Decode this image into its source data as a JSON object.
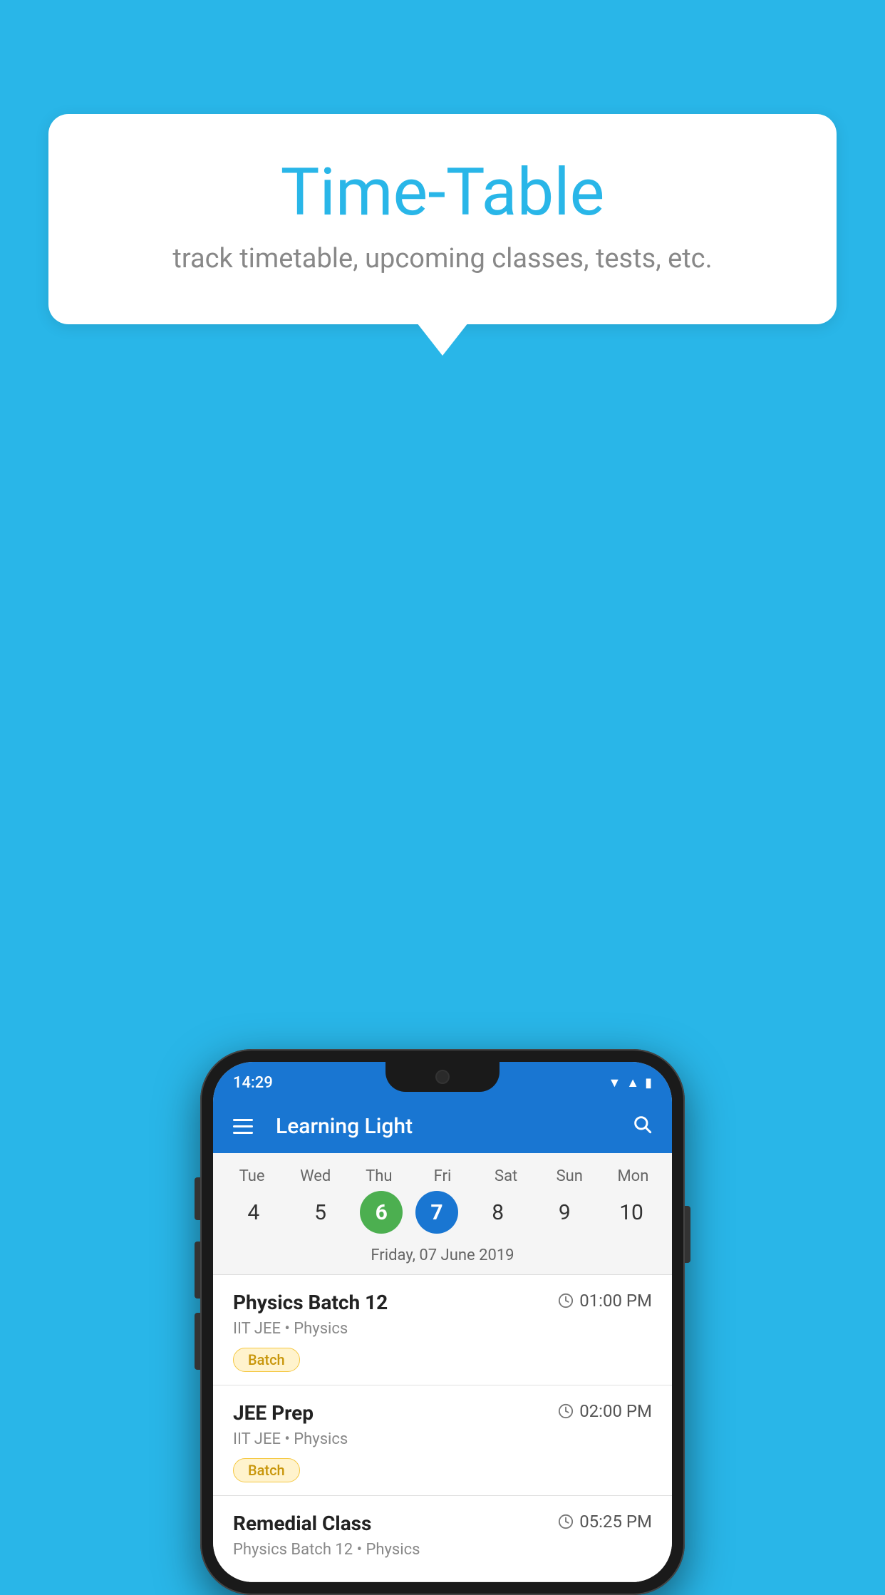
{
  "background": {
    "color": "#29b6e8"
  },
  "tooltip": {
    "title": "Time-Table",
    "subtitle": "track timetable, upcoming classes, tests, etc."
  },
  "phone": {
    "status_bar": {
      "time": "14:29",
      "signal_icon": "▲",
      "wifi_icon": "▼",
      "battery_icon": "▮"
    },
    "app_bar": {
      "title": "Learning Light",
      "menu_icon": "hamburger",
      "search_icon": "search"
    },
    "calendar": {
      "days": [
        {
          "label": "Tue",
          "num": "4"
        },
        {
          "label": "Wed",
          "num": "5"
        },
        {
          "label": "Thu",
          "num": "6",
          "state": "today"
        },
        {
          "label": "Fri",
          "num": "7",
          "state": "selected"
        },
        {
          "label": "Sat",
          "num": "8"
        },
        {
          "label": "Sun",
          "num": "9"
        },
        {
          "label": "Mon",
          "num": "10"
        }
      ],
      "selected_date_label": "Friday, 07 June 2019"
    },
    "schedule": [
      {
        "title": "Physics Batch 12",
        "time": "01:00 PM",
        "subtitle": "IIT JEE • Physics",
        "badge": "Batch"
      },
      {
        "title": "JEE Prep",
        "time": "02:00 PM",
        "subtitle": "IIT JEE • Physics",
        "badge": "Batch"
      },
      {
        "title": "Remedial Class",
        "time": "05:25 PM",
        "subtitle": "Physics Batch 12 • Physics",
        "badge": ""
      }
    ]
  }
}
